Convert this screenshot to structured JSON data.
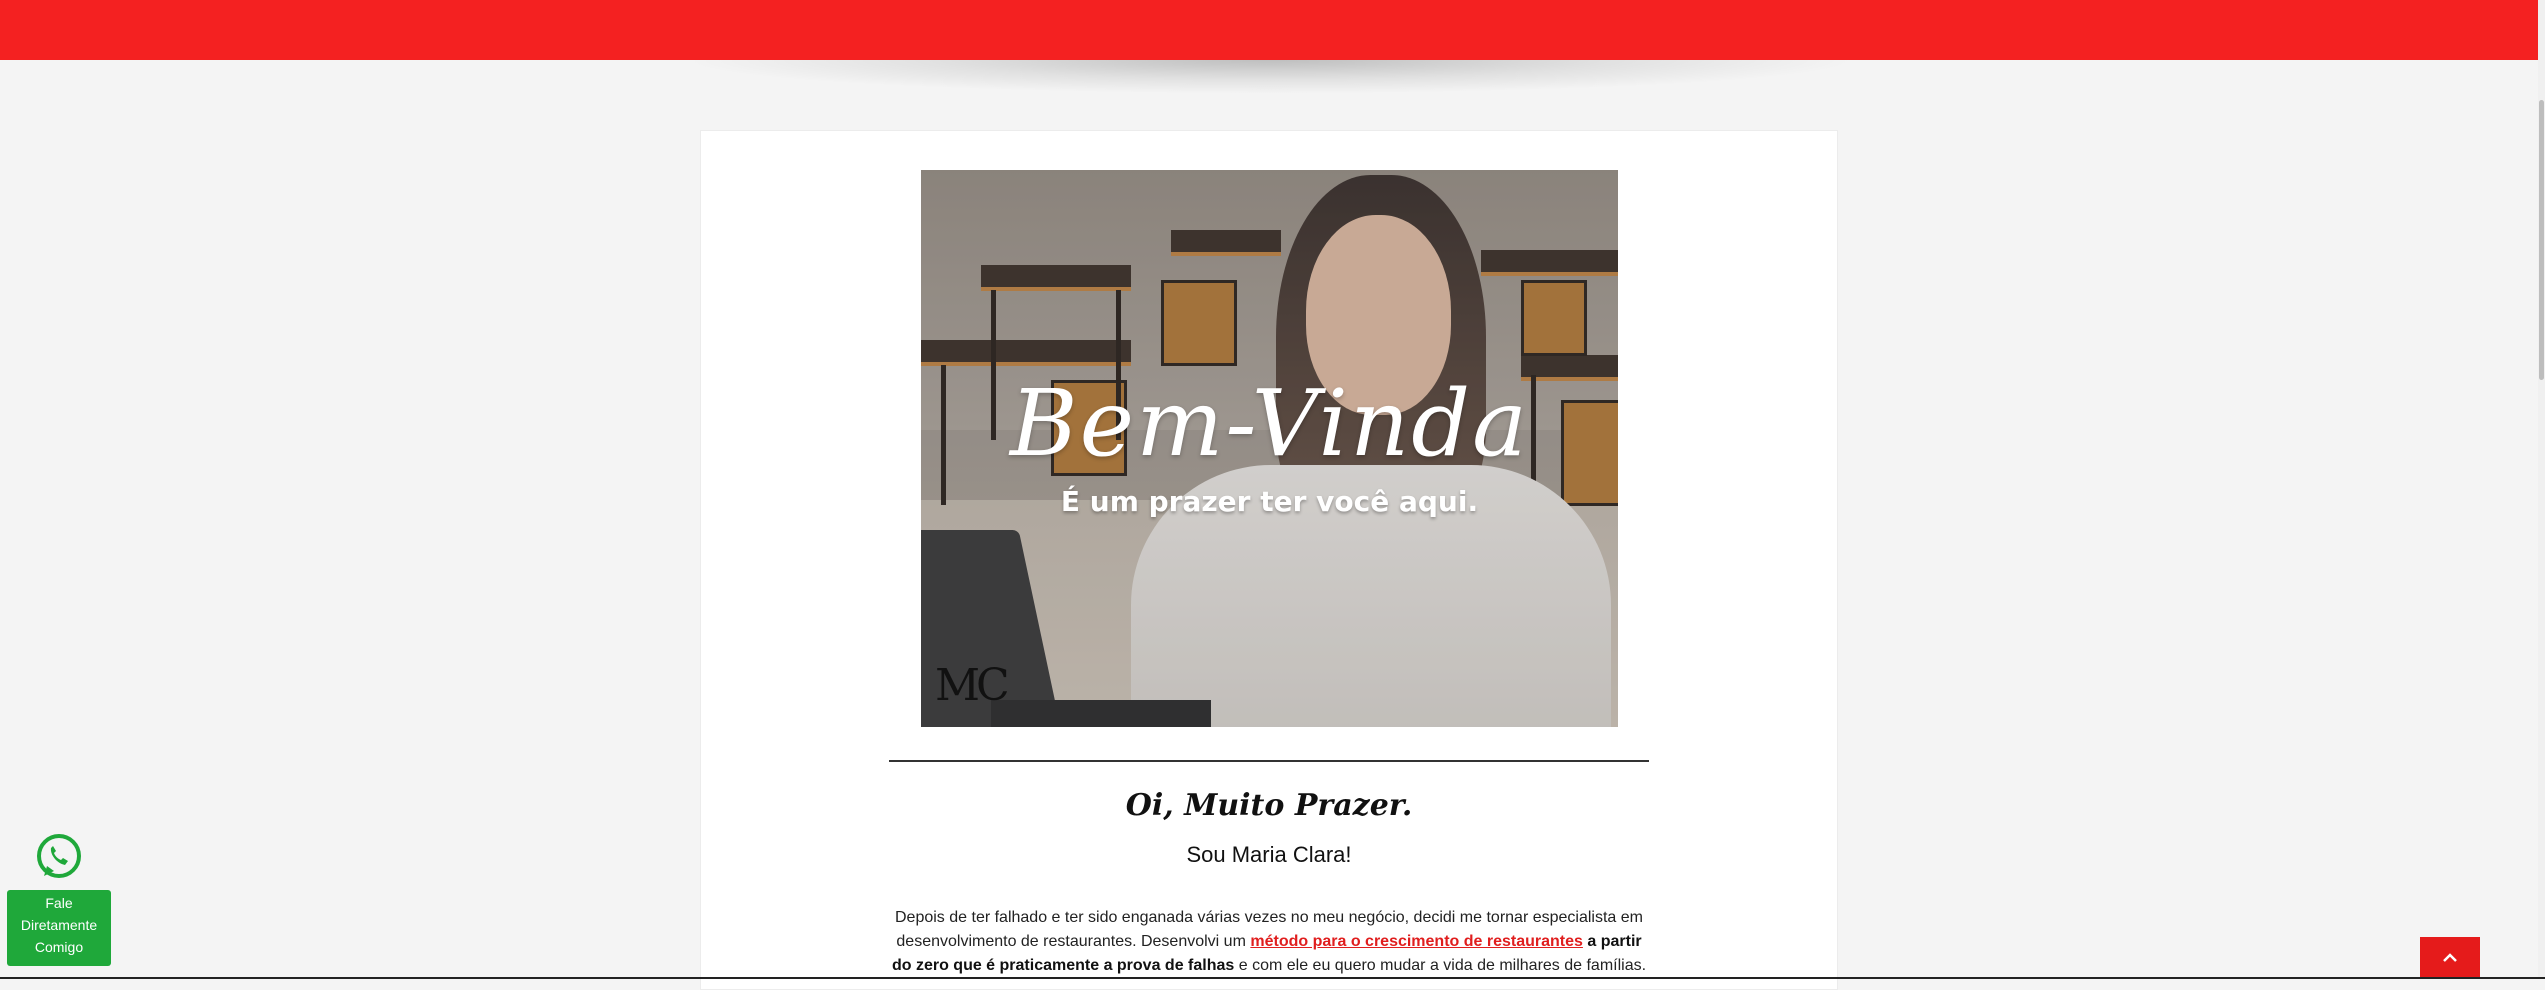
{
  "header": {
    "accent_color": "#f42121"
  },
  "hero": {
    "title": "Bem-Vinda",
    "subtitle": "É um prazer ter você aqui.",
    "logo_text": "MC"
  },
  "intro": {
    "greeting": "Oi, Muito Prazer.",
    "name": "Sou Maria Clara!",
    "bio_part1": "Depois de ter falhado e ter sido enganada várias vezes no meu negócio, decidi me tornar especialista em desenvolvimento de restaurantes. Desenvolvi um ",
    "bio_link": "método para o crescimento de restaurantes",
    "bio_part2": " a partir do zero que é praticamente a prova de falhas",
    "bio_part3": " e com ele eu quero mudar a vida de milhares de famílias."
  },
  "whatsapp": {
    "icon": "whatsapp-icon",
    "line1": "Fale",
    "line2": "Diretamente",
    "line3": "Comigo",
    "color": "#1fa83a"
  },
  "scroll_top": {
    "icon": "chevron-up-icon",
    "color": "#e51b1b"
  }
}
